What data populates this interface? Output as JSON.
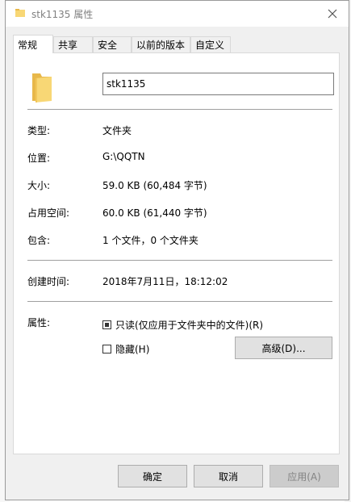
{
  "window": {
    "title": "stk1135 属性",
    "close_icon": "close-icon"
  },
  "tabs": [
    {
      "label": "常规",
      "active": true
    },
    {
      "label": "共享",
      "active": false
    },
    {
      "label": "安全",
      "active": false
    },
    {
      "label": "以前的版本",
      "active": false
    },
    {
      "label": "自定义",
      "active": false
    }
  ],
  "general": {
    "folder_name": "stk1135",
    "rows": [
      {
        "label": "类型:",
        "value": "文件夹"
      },
      {
        "label": "位置:",
        "value": "G:\\QQTN"
      },
      {
        "label": "大小:",
        "value": "59.0 KB (60,484 字节)"
      },
      {
        "label": "占用空间:",
        "value": "60.0 KB (61,440 字节)"
      },
      {
        "label": "包含:",
        "value": "1 个文件，0 个文件夹"
      }
    ],
    "created_label": "创建时间:",
    "created_value": "2018年7月11日，18:12:02",
    "attributes_label": "属性:",
    "readonly_label": "只读(仅应用于文件夹中的文件)(R)",
    "readonly_state": "indeterminate",
    "hidden_label": "隐藏(H)",
    "hidden_checked": false,
    "advanced_label": "高级(D)..."
  },
  "buttons": {
    "ok": "确定",
    "cancel": "取消",
    "apply": "应用(A)"
  },
  "colors": {
    "folder": "#f8d775",
    "folder_dark": "#e8b84a",
    "dialog_bg": "#f0f0f0"
  }
}
